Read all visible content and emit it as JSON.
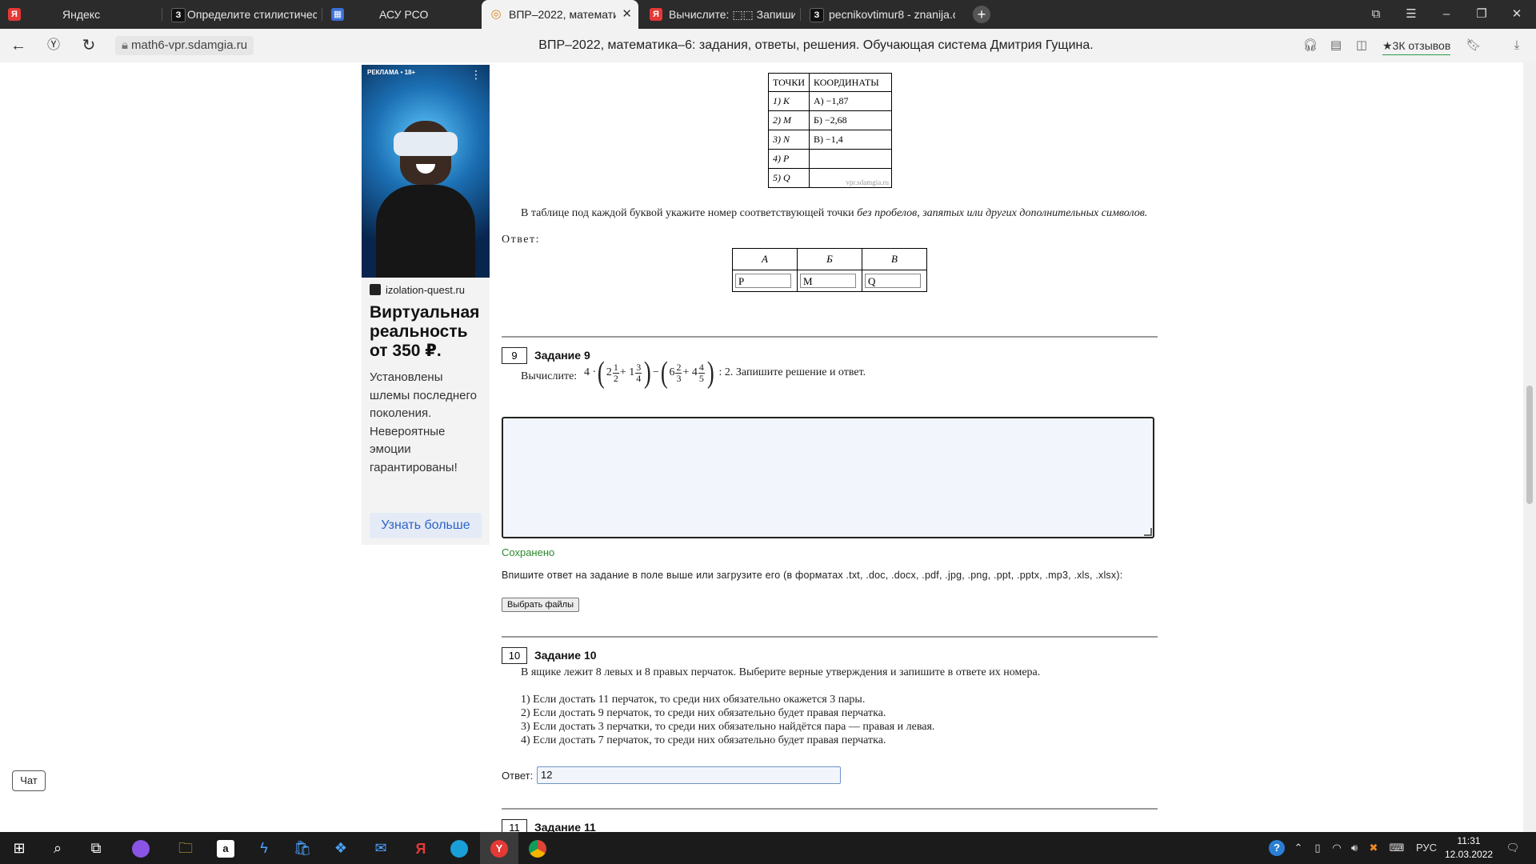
{
  "browser": {
    "tabs": [
      {
        "title": "Яндекс",
        "favicon": "Я",
        "color": "#e53935"
      },
      {
        "title": "Определите стилистическ",
        "favicon": "З",
        "color": "#222222"
      },
      {
        "title": "АСУ РСО",
        "favicon": "▦",
        "color": "#3a6fd8"
      },
      {
        "title": "ВПР–2022, математика",
        "favicon": "◎",
        "color": "#d88a2a"
      },
      {
        "title": "Вычислите: ⬚⬚ Запишите",
        "favicon": "Я",
        "color": "#e53935"
      },
      {
        "title": "pecnikovtimur8 - znanija.co",
        "favicon": "З",
        "color": "#222222"
      }
    ],
    "url_host": "math6-vpr.sdamgia.ru",
    "page_title": "ВПР–2022, математика–6: задания, ответы, решения. Обучающая система Дмитрия Гущина.",
    "reviews": "★3К отзывов"
  },
  "ad": {
    "label": "РЕКЛАМА • 18+",
    "source": "izolation-quest.ru",
    "title": "Виртуальная реальность от 350 ₽.",
    "text": "Установлены шлемы последнего поколения. Невероятные эмоции гарантированы!",
    "button": "Узнать больше"
  },
  "task8": {
    "table_headers": [
      "ТОЧКИ",
      "КООРДИНАТЫ"
    ],
    "rows": [
      {
        "point": "1) K",
        "coord": "А) −1,87"
      },
      {
        "point": "2) M",
        "coord": "Б) −2,68"
      },
      {
        "point": "3) N",
        "coord": "В) −1,4"
      },
      {
        "point": "4) P",
        "coord": ""
      },
      {
        "point": "5) Q",
        "coord": ""
      }
    ],
    "watermark": "vpr.sdamgia.ru",
    "instruction_plain": "В таблице под каждой буквой укажите номер соответствующей точки ",
    "instruction_italic": "без пробелов, запятых или других дополнительных символов.",
    "answer_label": "Ответ:",
    "answer_headers": [
      "А",
      "Б",
      "В"
    ],
    "answer_values": [
      "P",
      "M",
      "Q"
    ]
  },
  "task9": {
    "number": "9",
    "title": "Задание 9",
    "prefix": "Вычислите:",
    "suffix": ": 2. Запишите решение и ответ.",
    "saved": "Сохранено",
    "upload_text": "Впишите ответ на задание в поле выше или загрузите его (в форматах .txt, .doc, .docx, .pdf, .jpg, .png, .ppt, .pptx, .mp3, .xls, .xlsx):",
    "file_button": "Выбрать файлы"
  },
  "task10": {
    "number": "10",
    "title": "Задание 10",
    "text": "В ящике лежит 8 левых и 8 правых перчаток. Выберите верные утверждения и запишите в ответе их номера.",
    "items": [
      "1) Если достать 11 перчаток, то среди них обязательно окажется 3 пары.",
      "2) Если достать 9 перчаток, то среди них обязательно будет правая перчатка.",
      "3) Если достать 3 перчатки, то среди них обязательно найдётся пара — правая и левая.",
      "4) Если достать 7 перчаток, то среди них обязательно будет правая перчатка."
    ],
    "answer_label": "Ответ:",
    "answer_value": "12"
  },
  "task11": {
    "number": "11",
    "title": "Задание 11"
  },
  "chat": "Чат",
  "taskbar": {
    "lang": "РУС",
    "time": "11:31",
    "date": "12.03.2022"
  }
}
